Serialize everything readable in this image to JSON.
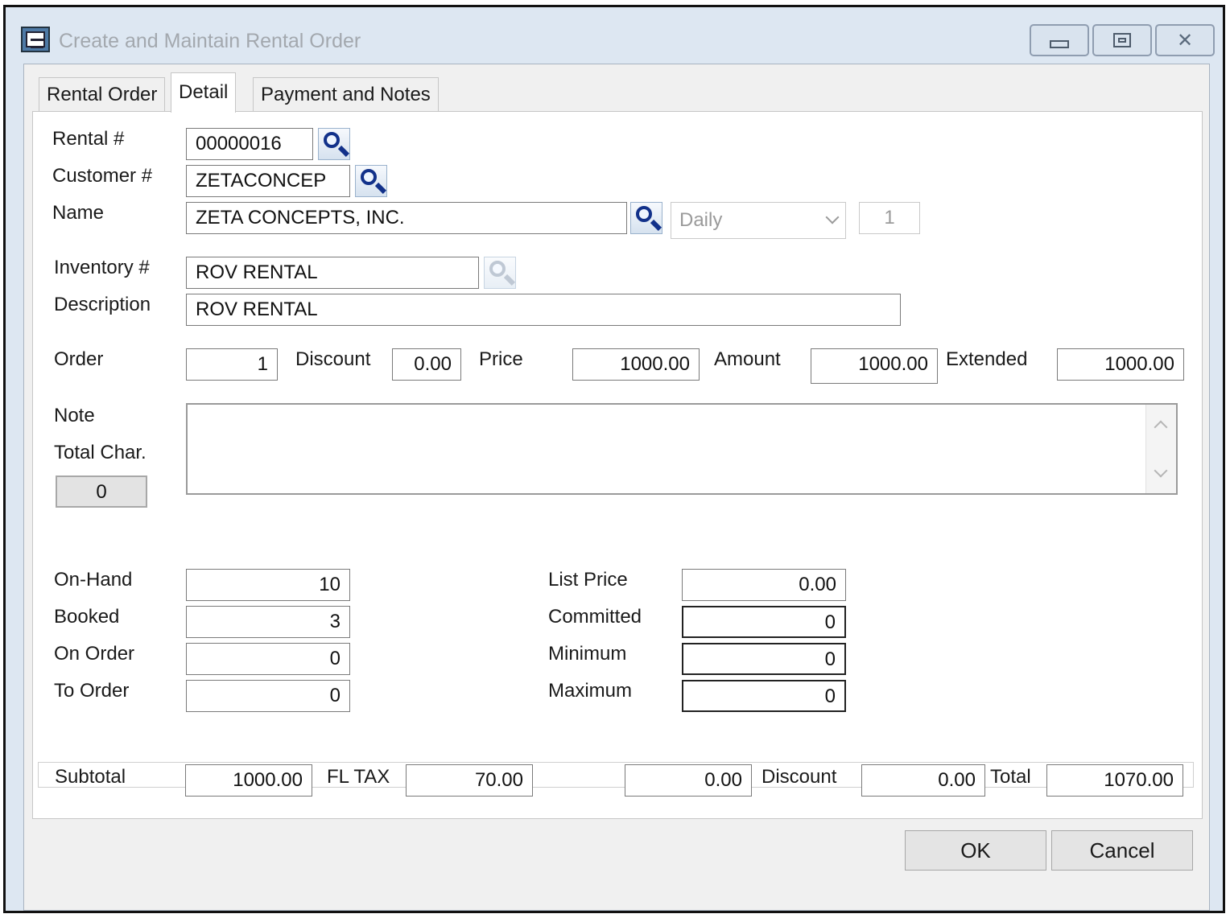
{
  "window": {
    "title": "Create and Maintain Rental Order"
  },
  "tabs": [
    {
      "label": "Rental Order"
    },
    {
      "label": "Detail"
    },
    {
      "label": "Payment and Notes"
    }
  ],
  "header": {
    "rental_label": "Rental #",
    "rental_value": "00000016",
    "customer_label": "Customer #",
    "customer_value": "ZETACONCEP",
    "name_label": "Name",
    "name_value": "ZETA CONCEPTS, INC.",
    "period_value": "Daily",
    "period_qty": "1"
  },
  "item": {
    "inventory_label": "Inventory #",
    "inventory_value": "ROV RENTAL",
    "description_label": "Description",
    "description_value": "ROV RENTAL"
  },
  "line": {
    "order_label": "Order",
    "order_value": "1",
    "discount_label": "Discount",
    "discount_value": "0.00",
    "price_label": "Price",
    "price_value": "1000.00",
    "amount_label": "Amount",
    "amount_value": "1000.00",
    "extended_label": "Extended",
    "extended_value": "1000.00"
  },
  "note": {
    "note_label": "Note",
    "total_char_label": "Total Char.",
    "total_char_value": "0"
  },
  "stock": {
    "onhand_label": "On-Hand",
    "onhand_value": "10",
    "booked_label": "Booked",
    "booked_value": "3",
    "onorder_label": "On Order",
    "onorder_value": "0",
    "toorder_label": "To Order",
    "toorder_value": "0",
    "listprice_label": "List Price",
    "listprice_value": "0.00",
    "committed_label": "Committed",
    "committed_value": "0",
    "minimum_label": "Minimum",
    "minimum_value": "0",
    "maximum_label": "Maximum",
    "maximum_value": "0"
  },
  "totals": {
    "subtotal_label": "Subtotal",
    "subtotal_value": "1000.00",
    "tax_label": "FL TAX",
    "tax_value": "70.00",
    "other_value": "0.00",
    "discount_label": "Discount",
    "discount_value": "0.00",
    "total_label": "Total",
    "total_value": "1070.00"
  },
  "buttons": {
    "ok": "OK",
    "cancel": "Cancel"
  }
}
